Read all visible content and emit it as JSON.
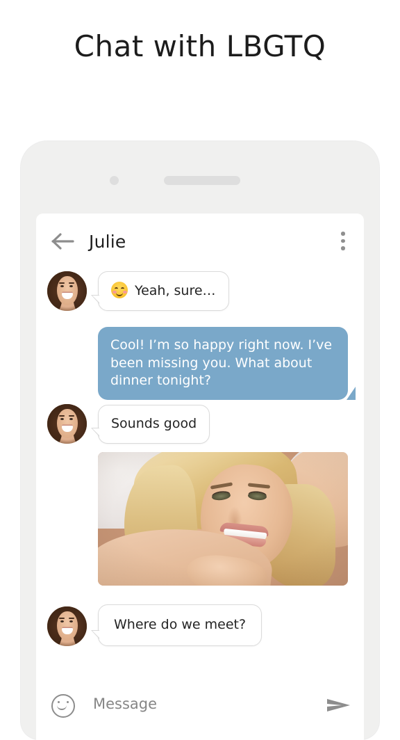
{
  "headline": "Chat with LBGTQ",
  "phone": {
    "camera_icon": "camera-dot",
    "speaker_icon": "speaker-grille"
  },
  "appbar": {
    "back_icon": "back-arrow-icon",
    "title": "Julie",
    "menu_icon": "overflow-menu-icon"
  },
  "messages": [
    {
      "id": "msg-1",
      "side": "left",
      "avatar": "contact-avatar",
      "emoji": "smiling-face-with-smiling-eyes",
      "text": "Yeah, sure…"
    },
    {
      "id": "msg-2",
      "side": "right",
      "text": "Cool! I’m so happy right now. I’ve been missing you. What about dinner tonight?"
    },
    {
      "id": "msg-3",
      "side": "left",
      "avatar": "contact-avatar",
      "text": "Sounds good"
    },
    {
      "id": "msg-4",
      "side": "left",
      "type": "photo",
      "alt": "photo-of-smiling-blonde-woman"
    },
    {
      "id": "msg-5",
      "side": "left",
      "avatar": "contact-avatar",
      "text": "Where do we meet?"
    }
  ],
  "input": {
    "emoji_icon": "smiley-face-icon",
    "placeholder": "Message",
    "value": "",
    "send_icon": "send-arrow-icon"
  },
  "colors": {
    "outgoing_bubble": "#7aa8c9",
    "incoming_bubble": "#ffffff",
    "phone_body": "#f0f0ef",
    "page_background": "#ffffff",
    "title_text": "#1c1c1c",
    "icon_gray": "#8d8d8d"
  }
}
